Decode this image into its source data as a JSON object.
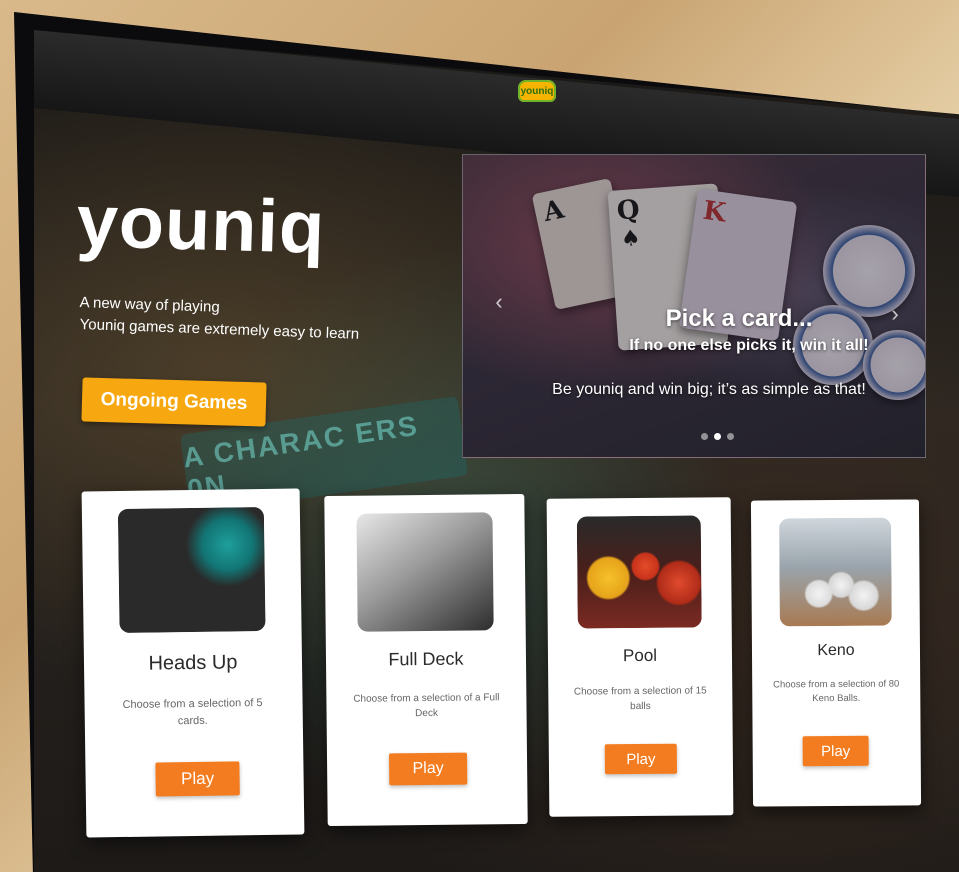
{
  "header": {
    "logo_text": "youniq"
  },
  "hero": {
    "title": "youniq",
    "line1": "A new way of playing",
    "line2": "Youniq games are extremely easy to learn",
    "cta_label": "Ongoing Games"
  },
  "background": {
    "slot_text": "A CHARAC ERS 0N"
  },
  "carousel": {
    "title": "Pick a card...",
    "subtitle": "If no one else picks it, win it all!",
    "caption": "Be youniq and win big; it’s as simple as that!",
    "prev_icon": "chevron-left-icon",
    "next_icon": "chevron-right-icon",
    "slide_count": 3,
    "active_slide": 2
  },
  "games": [
    {
      "name": "Heads Up",
      "description": "Choose from a selection of 5 cards.",
      "button": "Play"
    },
    {
      "name": "Full Deck",
      "description": "Choose from a selection of a Full Deck",
      "button": "Play"
    },
    {
      "name": "Pool",
      "description": "Choose from a selection of 15 balls",
      "button": "Play"
    },
    {
      "name": "Keno",
      "description": "Choose from a selection of 80 Keno Balls.",
      "button": "Play"
    }
  ],
  "colors": {
    "accent_yellow": "#f7a70f",
    "accent_orange": "#f47c20"
  }
}
